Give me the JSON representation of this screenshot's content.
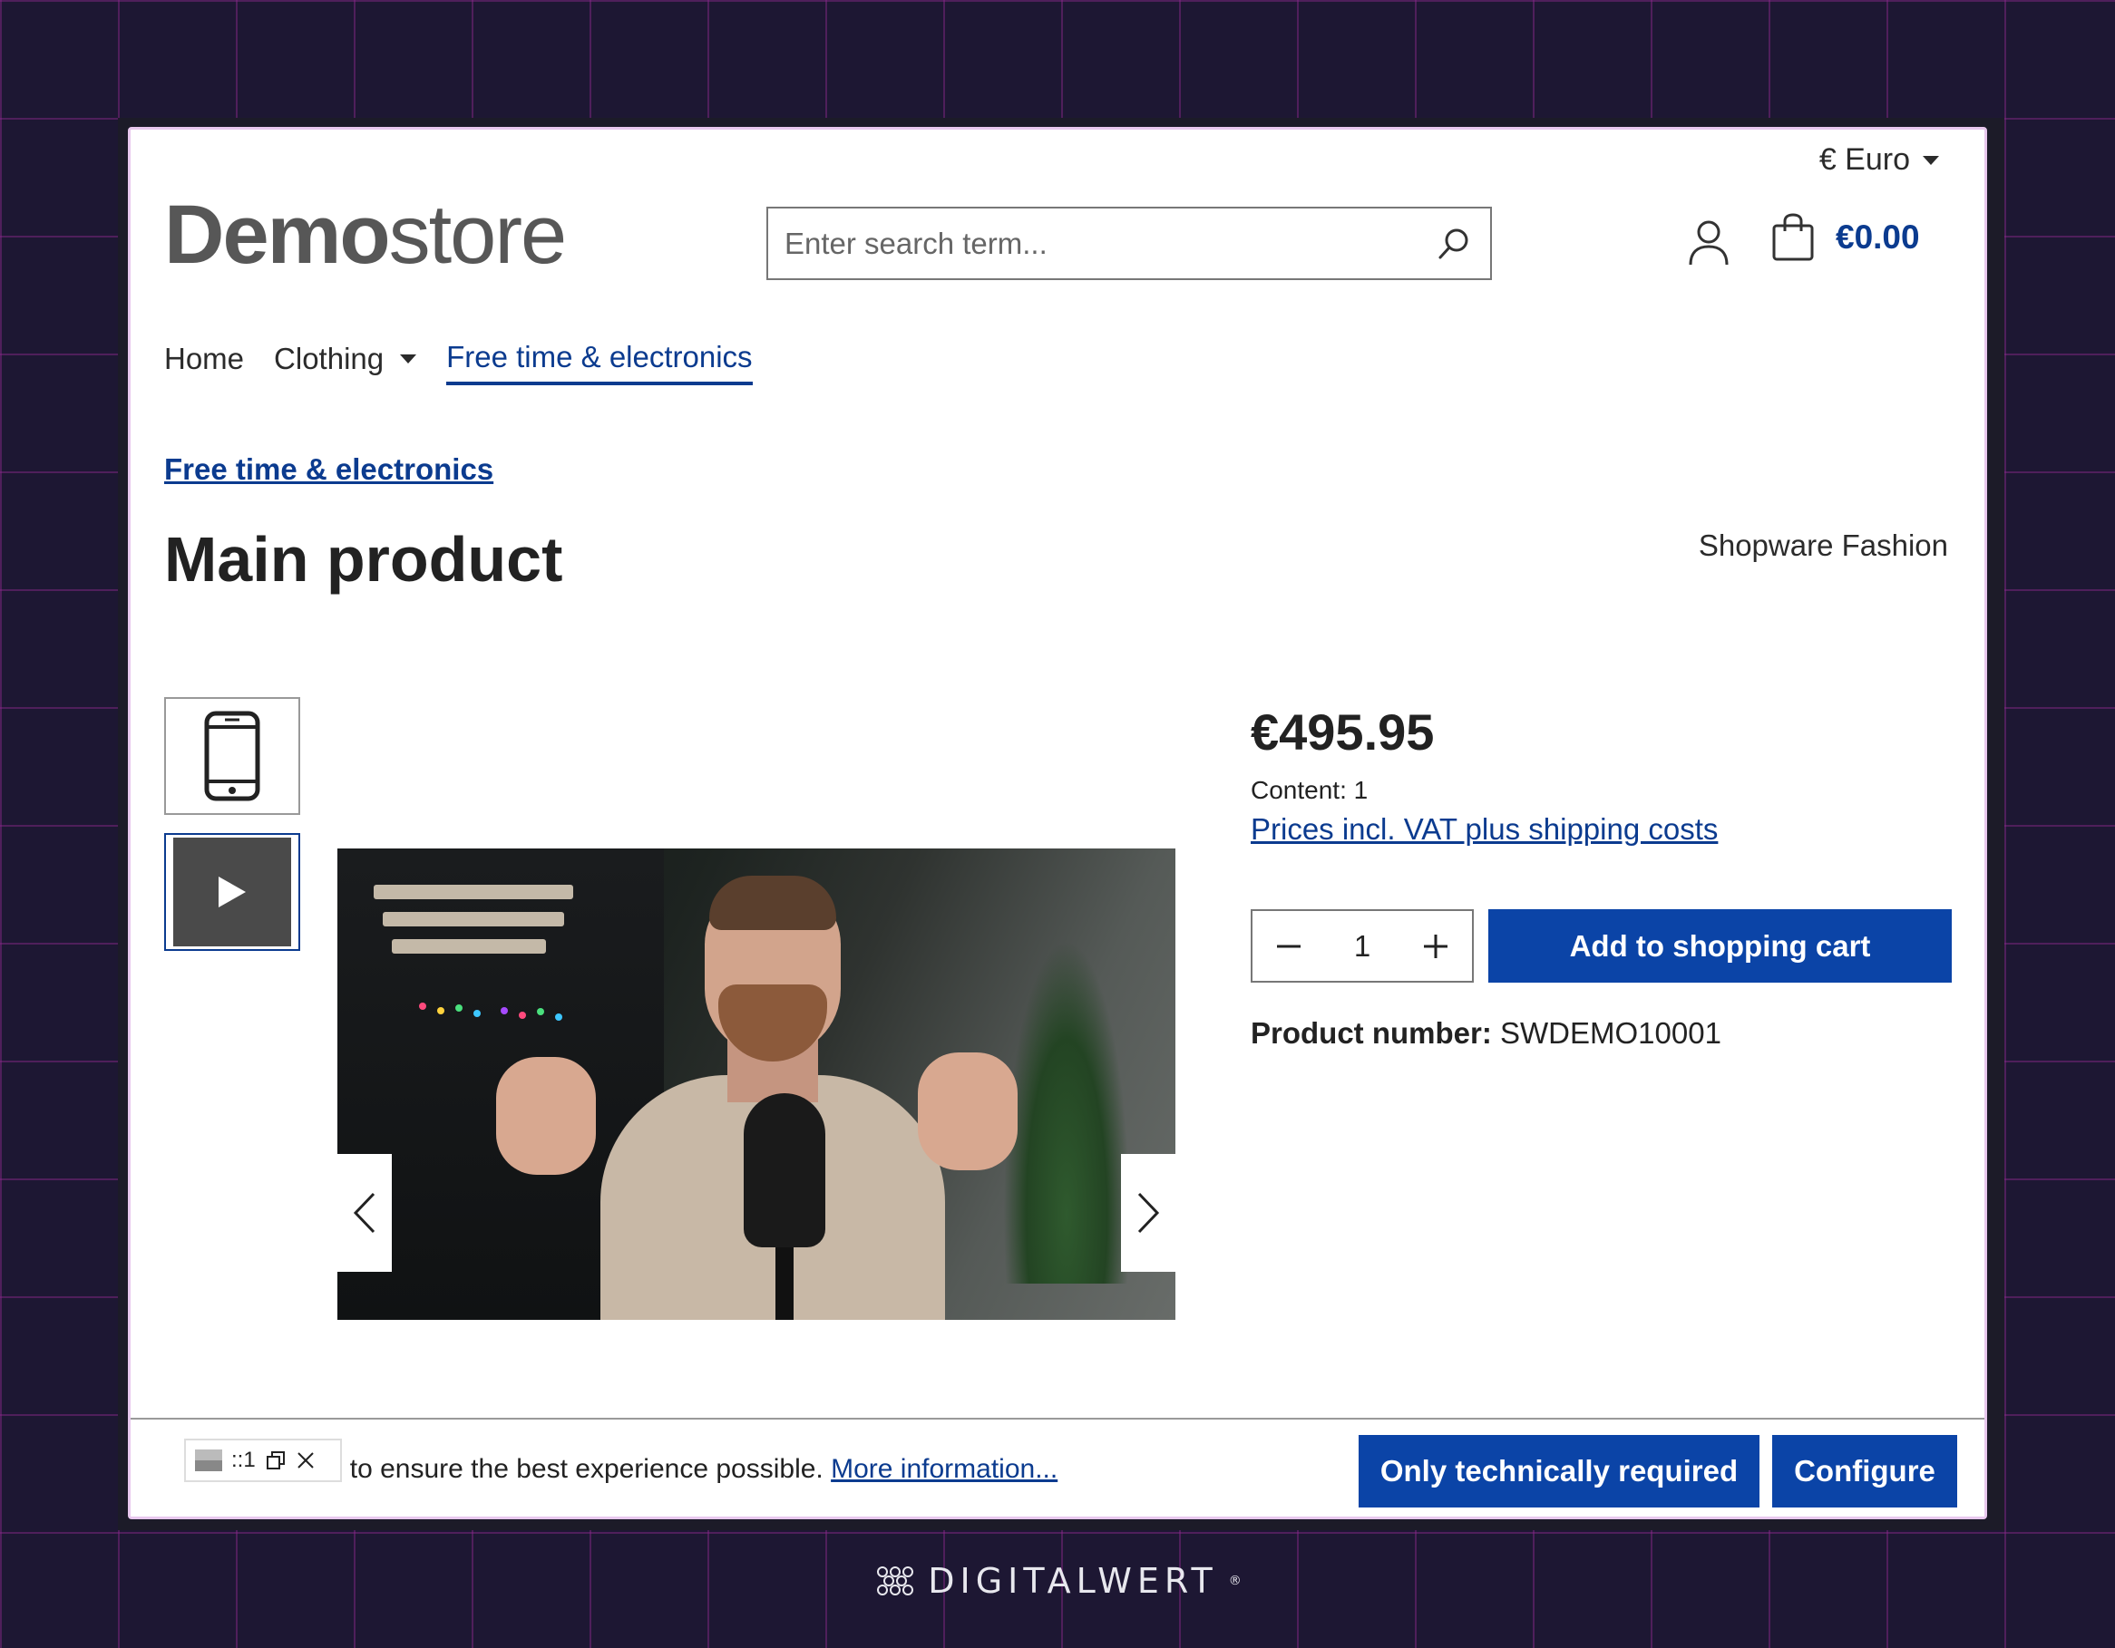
{
  "header": {
    "currency_label": "€ Euro",
    "logo_bold": "Demo",
    "logo_light": "store",
    "search_placeholder": "Enter search term...",
    "cart_total": "€0.00"
  },
  "nav": {
    "items": [
      {
        "label": "Home"
      },
      {
        "label": "Clothing"
      },
      {
        "label": "Free time & electronics"
      }
    ]
  },
  "product": {
    "breadcrumb": "Free time & electronics",
    "title": "Main product",
    "manufacturer": "Shopware Fashion",
    "price": "€495.95",
    "content": "Content: 1",
    "vat_link": "Prices incl. VAT plus shipping costs",
    "quantity": "1",
    "add_to_cart": "Add to shopping cart",
    "number_label": "Product number:",
    "number_value": "SWDEMO10001"
  },
  "cookie": {
    "text": "uses cookies to ensure the best experience possible.",
    "more_info": "More information...",
    "btn_technical": "Only technically required",
    "btn_configure": "Configure"
  },
  "toolbar": {
    "label": "::1"
  },
  "footer": {
    "brand": "DIGITALWERT",
    "brand_mark": "®"
  },
  "colors": {
    "primary": "#0b44a7",
    "link": "#0b3b8f",
    "background": "#1d1733"
  }
}
